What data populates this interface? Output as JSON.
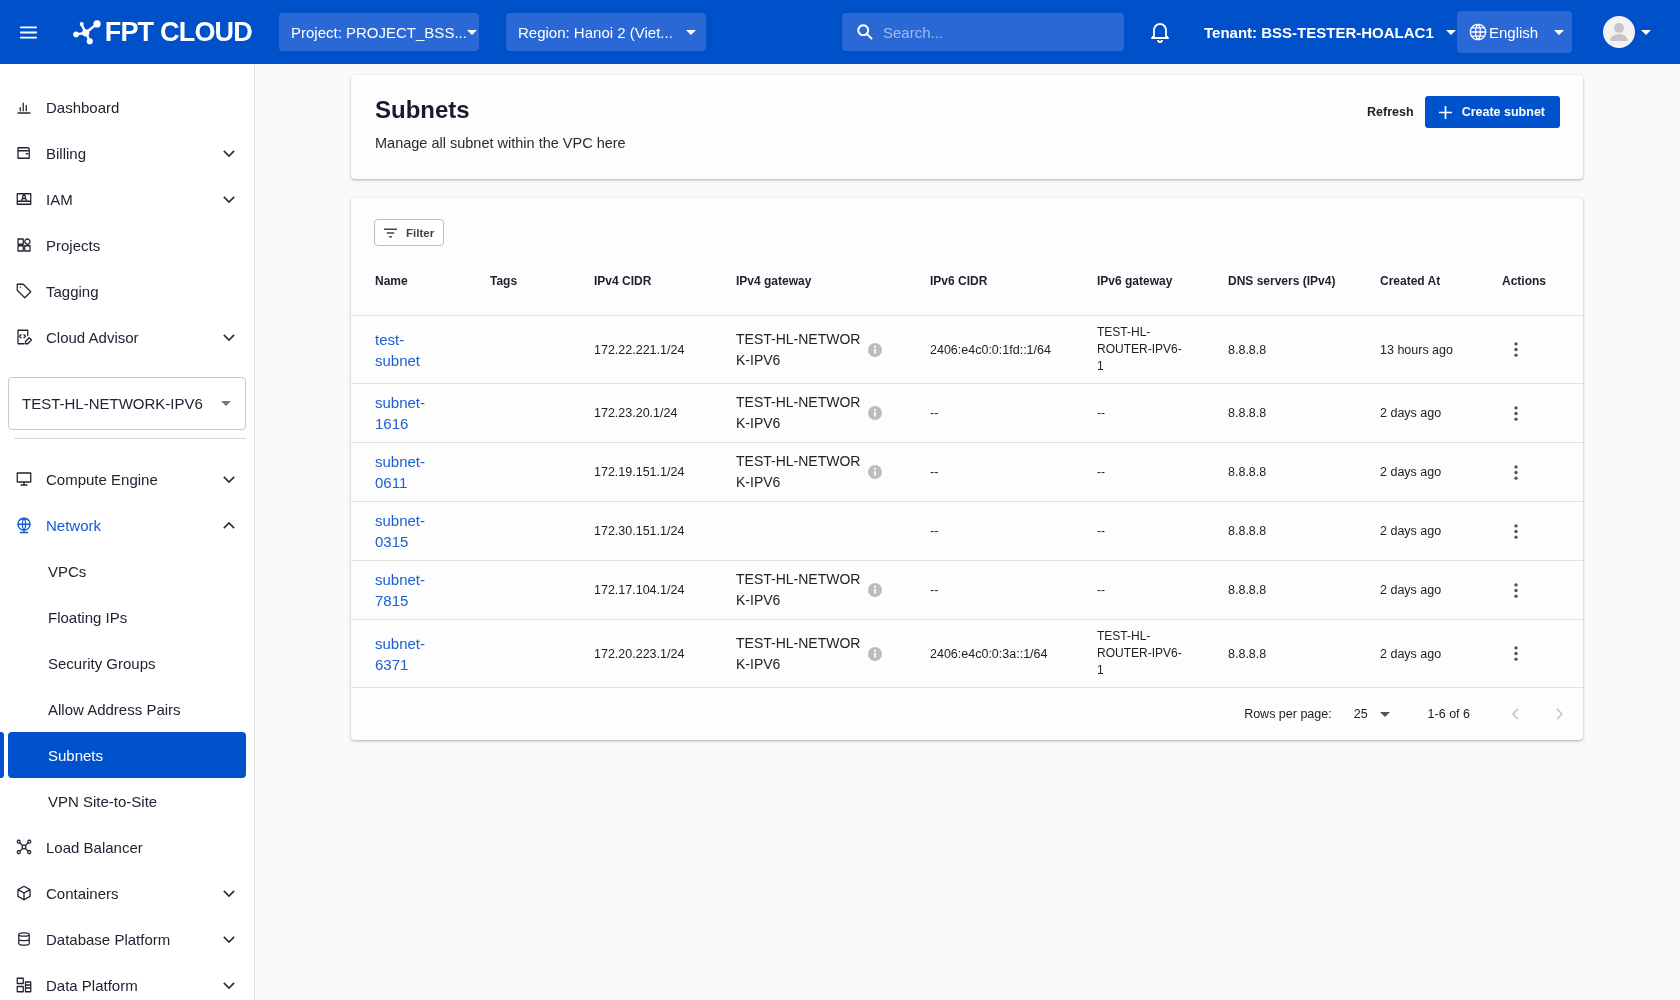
{
  "topbar": {
    "logo": "FPT CLOUD",
    "project_select": "Project: PROJECT_BSS...",
    "region_select": "Region: Hanoi 2 (Viet...",
    "search": {
      "placeholder": "Search..."
    },
    "tenant": "Tenant: BSS-TESTER-HOALAC1",
    "language": "English"
  },
  "sidebar": {
    "top_items": [
      {
        "label": "Dashboard",
        "kind": "link",
        "selected": false
      },
      {
        "label": "Billing",
        "kind": "group",
        "expanded": false,
        "selected": false
      },
      {
        "label": "IAM",
        "kind": "group",
        "expanded": false,
        "selected": false
      },
      {
        "label": "Projects",
        "kind": "link",
        "selected": false
      },
      {
        "label": "Tagging",
        "kind": "link",
        "selected": false
      },
      {
        "label": "Cloud Advisor",
        "kind": "group",
        "expanded": false,
        "selected": false
      }
    ],
    "project_select": {
      "value": "TEST-HL-NETWORK-IPV6"
    },
    "items": [
      {
        "label": "Compute Engine",
        "kind": "group",
        "expanded": false,
        "selected": false
      },
      {
        "label": "Network",
        "kind": "group",
        "expanded": true,
        "selected": true,
        "children": [
          {
            "label": "VPCs",
            "selected": false
          },
          {
            "label": "Floating IPs",
            "selected": false
          },
          {
            "label": "Security Groups",
            "selected": false
          },
          {
            "label": "Allow Address Pairs",
            "selected": false
          },
          {
            "label": "Subnets",
            "selected": true
          },
          {
            "label": "VPN Site-to-Site",
            "selected": false
          }
        ]
      },
      {
        "label": "Load Balancer",
        "kind": "link",
        "selected": false
      },
      {
        "label": "Containers",
        "kind": "group",
        "expanded": false,
        "selected": false
      },
      {
        "label": "Database Platform",
        "kind": "group",
        "expanded": false,
        "selected": false
      },
      {
        "label": "Data Platform",
        "kind": "group",
        "expanded": false,
        "selected": false
      }
    ]
  },
  "page_header": {
    "title": "Subnets",
    "subtitle": "Manage all subnet within the VPC here",
    "refresh_button": "Refresh",
    "create_button": "Create subnet"
  },
  "table": {
    "filter_button": "Filter",
    "columns": [
      "Name",
      "Tags",
      "IPv4 CIDR",
      "IPv4 gateway",
      "IPv6 CIDR",
      "IPv6 gateway",
      "DNS servers (IPv4)",
      "Created At",
      "Actions"
    ],
    "rows": [
      {
        "name": "test-subnet",
        "ipv4_cidr": "172.22.221.1/24",
        "ipv4_gateway": "TEST-HL-NETWORK-IPV6",
        "ipv6_cidr": "2406:e4c0:0:1fd::1/64",
        "ipv6_gateway": "TEST-HL-ROUTER-IPV6-1",
        "dns": "8.8.8.8",
        "created_at": "13 hours ago"
      },
      {
        "name": "subnet-1616",
        "ipv4_cidr": "172.23.20.1/24",
        "ipv4_gateway": "TEST-HL-NETWORK-IPV6",
        "ipv6_cidr": "--",
        "ipv6_gateway": "--",
        "dns": "8.8.8.8",
        "created_at": "2 days ago"
      },
      {
        "name": "subnet-0611",
        "ipv4_cidr": "172.19.151.1/24",
        "ipv4_gateway": "TEST-HL-NETWORK-IPV6",
        "ipv6_cidr": "--",
        "ipv6_gateway": "--",
        "dns": "8.8.8.8",
        "created_at": "2 days ago"
      },
      {
        "name": "subnet-0315",
        "ipv4_cidr": "172.30.151.1/24",
        "ipv6_cidr": "--",
        "ipv6_gateway": "--",
        "dns": "8.8.8.8",
        "created_at": "2 days ago"
      },
      {
        "name": "subnet-7815",
        "ipv4_cidr": "172.17.104.1/24",
        "ipv4_gateway": "TEST-HL-NETWORK-IPV6",
        "ipv6_cidr": "--",
        "ipv6_gateway": "--",
        "dns": "8.8.8.8",
        "created_at": "2 days ago"
      },
      {
        "name": "subnet-6371",
        "ipv4_cidr": "172.20.223.1/24",
        "ipv4_gateway": "TEST-HL-NETWORK-IPV6",
        "ipv6_cidr": "2406:e4c0:0:3a::1/64",
        "ipv6_gateway": "TEST-HL-ROUTER-IPV6-1",
        "dns": "8.8.8.8",
        "created_at": "2 days ago"
      }
    ],
    "pagination": {
      "rows_per_page_label": "Rows per page:",
      "rows_per_page": "25",
      "range": "1-6 of 6",
      "previous_disabled": true,
      "next_disabled": true
    }
  }
}
